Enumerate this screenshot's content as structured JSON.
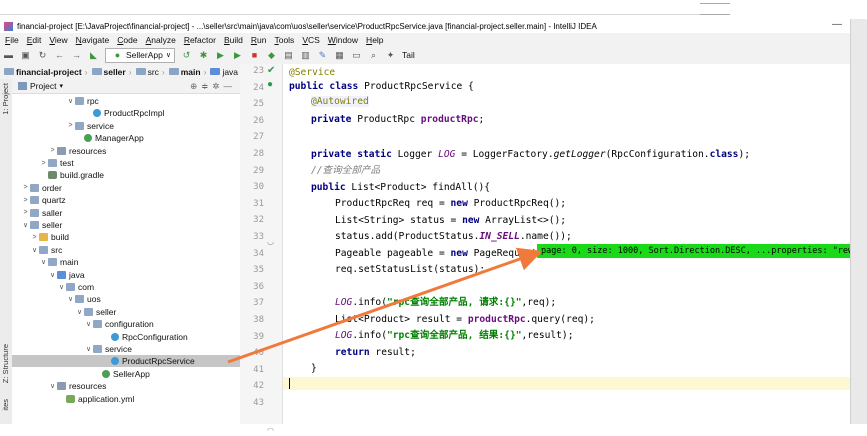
{
  "window": {
    "title": "financial-project [E:\\JavaProject\\financial-project] - ...\\seller\\src\\main\\java\\com\\uos\\seller\\service\\ProductRpcService.java [financial-project.seller.main] - IntelliJ IDEA",
    "minimize": "—"
  },
  "menu": [
    "File",
    "Edit",
    "View",
    "Navigate",
    "Code",
    "Analyze",
    "Refactor",
    "Build",
    "Run",
    "Tools",
    "VCS",
    "Window",
    "Help"
  ],
  "toolbar": {
    "run_config": "SellerApp",
    "tail_label": "Tail"
  },
  "navbar": {
    "crumbs": [
      "financial-project",
      "seller",
      "src",
      "main",
      "java",
      "c"
    ]
  },
  "side_labels": {
    "project": "1: Project",
    "structure": "Z: Structure",
    "favorites": "ites"
  },
  "project_panel": {
    "header": "Project",
    "tree": [
      {
        "label": "rpc",
        "depth": 6,
        "arrow": "∨",
        "icon": "folder"
      },
      {
        "label": "ProductRpcImpl",
        "depth": 8,
        "arrow": "",
        "icon": "class"
      },
      {
        "label": "service",
        "depth": 6,
        "arrow": ">",
        "icon": "folder"
      },
      {
        "label": "ManagerApp",
        "depth": 7,
        "arrow": "",
        "icon": "spring"
      },
      {
        "label": "resources",
        "depth": 4,
        "arrow": ">",
        "icon": "folder-res"
      },
      {
        "label": "test",
        "depth": 3,
        "arrow": ">",
        "icon": "folder"
      },
      {
        "label": "build.gradle",
        "depth": 3,
        "arrow": "",
        "icon": "gradle"
      },
      {
        "label": "order",
        "depth": 1,
        "arrow": ">",
        "icon": "folder"
      },
      {
        "label": "quartz",
        "depth": 1,
        "arrow": ">",
        "icon": "folder"
      },
      {
        "label": "saller",
        "depth": 1,
        "arrow": ">",
        "icon": "folder"
      },
      {
        "label": "seller",
        "depth": 1,
        "arrow": "∨",
        "icon": "folder"
      },
      {
        "label": "build",
        "depth": 2,
        "arrow": ">",
        "icon": "folder-orange"
      },
      {
        "label": "src",
        "depth": 2,
        "arrow": "∨",
        "icon": "folder"
      },
      {
        "label": "main",
        "depth": 3,
        "arrow": "∨",
        "icon": "folder"
      },
      {
        "label": "java",
        "depth": 4,
        "arrow": "∨",
        "icon": "folder-blue"
      },
      {
        "label": "com",
        "depth": 5,
        "arrow": "∨",
        "icon": "folder"
      },
      {
        "label": "uos",
        "depth": 6,
        "arrow": "∨",
        "icon": "folder"
      },
      {
        "label": "seller",
        "depth": 7,
        "arrow": "∨",
        "icon": "folder"
      },
      {
        "label": "configuration",
        "depth": 8,
        "arrow": "∨",
        "icon": "folder"
      },
      {
        "label": "RpcConfiguration",
        "depth": 10,
        "arrow": "",
        "icon": "class"
      },
      {
        "label": "service",
        "depth": 8,
        "arrow": "∨",
        "icon": "folder"
      },
      {
        "label": "ProductRpcService",
        "depth": 10,
        "arrow": "",
        "icon": "class",
        "selected": true
      },
      {
        "label": "SellerApp",
        "depth": 9,
        "arrow": "",
        "icon": "spring"
      },
      {
        "label": "resources",
        "depth": 4,
        "arrow": "∨",
        "icon": "folder-res"
      },
      {
        "label": "application.yml",
        "depth": 5,
        "arrow": "",
        "icon": "yml"
      }
    ]
  },
  "tabs": [
    {
      "label": "oc.java"
    },
    {
      "label": "configuration\\RpcConfiguration.java"
    },
    {
      "label": "configurations\\RpcConfiguration.java"
    }
  ],
  "editor": {
    "line_numbers": [
      "23",
      "24",
      "25",
      "26",
      "27",
      "28",
      "29",
      "30",
      "31",
      "32",
      "33",
      "34",
      "35",
      "36",
      "37",
      "38",
      "39",
      "40",
      "41",
      "42",
      "43"
    ]
  },
  "tooltip": "page: 0, size: 1000, Sort.Direction.DESC, ...properties: \"rew",
  "colors": {
    "tooltip_bg": "#19d919",
    "highlight_border": "#e020c8",
    "arrow": "#f07a3c"
  }
}
